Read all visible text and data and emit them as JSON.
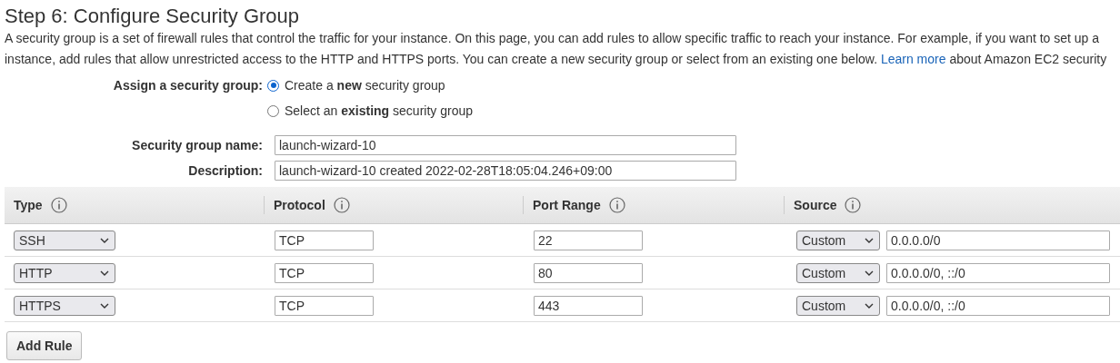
{
  "heading": "Step 6: Configure Security Group",
  "intro": [
    {
      "text": "A security group is a set of firewall rules that control the traffic for your instance. On this page, you can add rules to allow specific traffic to reach your instance. For example, if you want to set up a"
    },
    {
      "text": "instance, add rules that allow unrestricted access to the HTTP and HTTPS ports. You can create a new security group or select from an existing one below.",
      "link": "Learn more",
      "after": "about Amazon EC2 security"
    }
  ],
  "assign": {
    "label": "Assign a security group:",
    "options": [
      {
        "label": "Create a **new** security group",
        "selected": true
      },
      {
        "label": "Select an **existing** security group",
        "selected": false
      }
    ]
  },
  "fields": [
    {
      "label": "Security group name:",
      "value": "launch-wizard-10"
    },
    {
      "label": "Description:",
      "value": "launch-wizard-10 created 2022-02-28T18:05:04.246+09:00"
    }
  ],
  "table": {
    "columns": [
      "Type",
      "Protocol",
      "Port Range",
      "Source"
    ],
    "rows": [
      {
        "type": "SSH",
        "protocol": "TCP",
        "port_range": "22",
        "source": "Custom",
        "cidr": "0.0.0.0/0"
      },
      {
        "type": "HTTP",
        "protocol": "TCP",
        "port_range": "80",
        "source": "Custom",
        "cidr": "0.0.0.0/0, ::/0"
      },
      {
        "type": "HTTPS",
        "protocol": "TCP",
        "port_range": "443",
        "source": "Custom",
        "cidr": "0.0.0.0/0, ::/0"
      }
    ]
  },
  "add_rule_button": "Add Rule"
}
